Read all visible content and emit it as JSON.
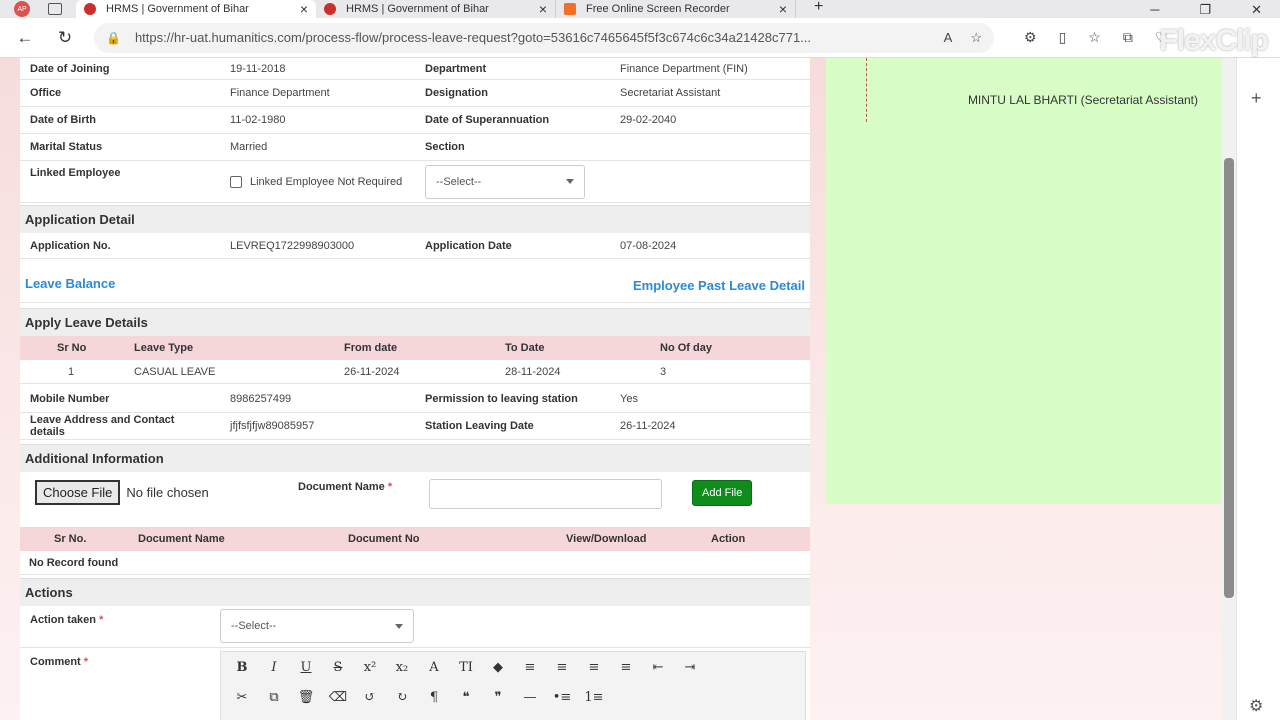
{
  "browser": {
    "profile_initials": "AP",
    "tabs": [
      {
        "title": "HRMS | Government of Bihar",
        "active": true
      },
      {
        "title": "HRMS | Government of Bihar",
        "active": false
      },
      {
        "title": "Free Online Screen Recorder",
        "active": false
      }
    ],
    "url": "https://hr-uat.humanitics.com/process-flow/process-leave-request?goto=53616c7465645f5f3c674c6c34a21428c771...",
    "watermark": "FlexClip"
  },
  "employee": {
    "date_of_joining_label": "Date of Joining",
    "date_of_joining": "19-11-2018",
    "department_label": "Department",
    "department": "Finance Department (FIN)",
    "office_label": "Office",
    "office": "Finance Department",
    "designation_label": "Designation",
    "designation": "Secretariat Assistant",
    "dob_label": "Date of Birth",
    "dob": "11-02-1980",
    "superannuation_label": "Date of Superannuation",
    "superannuation": "29-02-2040",
    "marital_label": "Marital Status",
    "marital": "Married",
    "section_label": "Section",
    "section": "",
    "linked_label": "Linked Employee",
    "linked_not_required": "Linked Employee Not Required",
    "linked_select": "--Select--"
  },
  "application": {
    "heading": "Application Detail",
    "no_label": "Application No.",
    "no": "LEVREQ1722998903000",
    "date_label": "Application Date",
    "date": "07-08-2024"
  },
  "links": {
    "leave_balance": "Leave Balance",
    "past_leave": "Employee Past Leave Detail"
  },
  "apply_leave": {
    "heading": "Apply Leave Details",
    "columns": [
      "Sr No",
      "Leave Type",
      "From date",
      "To Date",
      "No Of day"
    ],
    "rows": [
      [
        "1",
        "CASUAL LEAVE",
        "26-11-2024",
        "28-11-2024",
        "3"
      ]
    ],
    "mobile_label": "Mobile Number",
    "mobile": "8986257499",
    "permission_label": "Permission to leaving station",
    "permission": "Yes",
    "address_label": "Leave Address and Contact details",
    "address": "jfjfsfjfjw89085957",
    "station_date_label": "Station Leaving Date",
    "station_date": "26-11-2024"
  },
  "additional": {
    "heading": "Additional Information",
    "choose_file": "Choose File",
    "no_file": "No file chosen",
    "doc_name_label": "Document Name",
    "required_mark": "*",
    "add_file": "Add File",
    "columns": [
      "Sr No.",
      "Document Name",
      "Document No",
      "View/Download",
      "Action"
    ],
    "empty": "No Record found"
  },
  "actions": {
    "heading": "Actions",
    "action_taken_label": "Action taken",
    "action_select": "--Select--",
    "comment_label": "Comment"
  },
  "approver": {
    "name": "MINTU LAL BHARTI (Secretariat Assistant)"
  },
  "editor_toolbar": {
    "row1": [
      "B",
      "I",
      "U",
      "S",
      "x²",
      "x₂",
      "A",
      "TI",
      "◆",
      "≡",
      "≡",
      "≡",
      "≡",
      "⇤",
      "⇥"
    ],
    "row2": [
      "✂",
      "⧉",
      "🗑",
      "⌫",
      "↺",
      "↻",
      "¶",
      "❝",
      "❞",
      "—",
      "•≡",
      "1≡"
    ]
  }
}
